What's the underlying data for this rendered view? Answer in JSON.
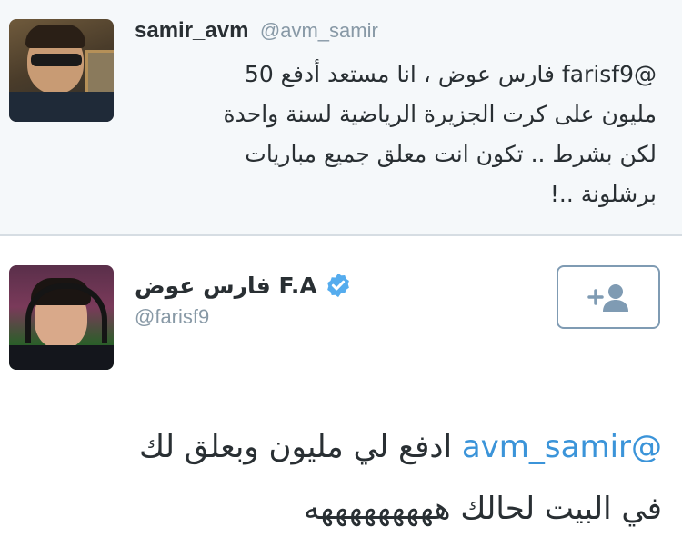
{
  "original_tweet": {
    "display_name": "samir_avm",
    "handle": "@avm_samir",
    "mention": "@farisf9",
    "line1_rest": " فارس عوض ، انا مستعد أدفع 50",
    "line2": "مليون على كرت الجزيرة الرياضية لسنة واحدة",
    "line3": "لكن بشرط .. تكون انت معلق جميع مباريات",
    "line4": "برشلونة ..!"
  },
  "reply_tweet": {
    "display_name": "فارس عوض F.A",
    "handle": "@farisf9",
    "verified_icon": "verified-badge-icon",
    "follow_icon": "follow-user-plus-icon",
    "mention": "@avm_samir",
    "line1_rest": " ادفع لي مليون وبعلق لك",
    "line2": "في البيت لحالك هههههههههه"
  },
  "colors": {
    "accent_blue": "#3b94d9",
    "follow_border": "#7f9bb3",
    "secondary_text": "#8899a6",
    "top_background": "#f5f8fa"
  }
}
